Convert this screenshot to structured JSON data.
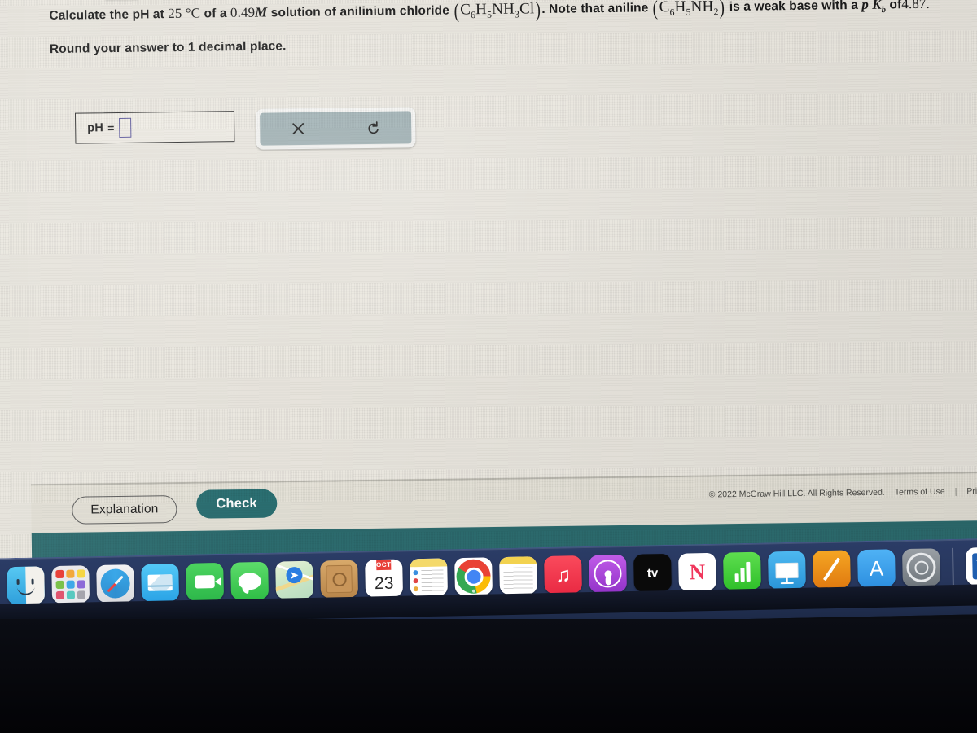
{
  "question": {
    "line1": {
      "part1": "Calculate the pH at",
      "temp": "25 °C",
      "part2": "of a",
      "conc": "0.49",
      "conc_unit": "M",
      "part3": "solution of anilinium chloride",
      "formula1": "C6H5NH3Cl",
      "part4": ". Note that aniline",
      "formula2": "C6H5NH2",
      "part5": "is a weak base with a",
      "pk_symbol": "pK",
      "pk_sub": "b",
      "part6": "of",
      "pk_value": "4.87",
      "period": "."
    },
    "line2": "Round your answer to 1 decimal place."
  },
  "answer": {
    "label": "pH",
    "equals": "=",
    "value": "",
    "placeholder": ""
  },
  "toolbar": {
    "clear_icon": "close-x-icon",
    "undo_icon": "undo-arrow-icon"
  },
  "top_nav": {
    "scroll_icon": "chevron-down-icon"
  },
  "actions": {
    "explanation_label": "Explanation",
    "check_label": "Check"
  },
  "footer": {
    "copyright": "© 2022 McGraw Hill LLC. All Rights Reserved.",
    "terms": "Terms of Use",
    "separator": "|",
    "privacy": "Privacy Ce"
  },
  "colors": {
    "teal": "#2b6f72",
    "page_bg": "#eae7df",
    "input_border": "#56529a",
    "toolbar_bg": "#9fb0b3",
    "dock_bg": "#27365c"
  },
  "dock": {
    "items": [
      {
        "name": "finder",
        "label": "Finder",
        "running": true
      },
      {
        "name": "launchpad",
        "label": "Launchpad",
        "running": false
      },
      {
        "name": "safari",
        "label": "Safari",
        "running": false
      },
      {
        "name": "mail",
        "label": "Mail",
        "running": false
      },
      {
        "name": "facetime",
        "label": "FaceTime",
        "running": false
      },
      {
        "name": "messages",
        "label": "Messages",
        "running": false
      },
      {
        "name": "maps",
        "label": "Maps",
        "running": false
      },
      {
        "name": "contacts",
        "label": "Contacts",
        "running": false
      },
      {
        "name": "calendar",
        "label": "Calendar",
        "month": "OCT",
        "day": "23",
        "running": false
      },
      {
        "name": "notes",
        "label": "Notes",
        "running": false
      },
      {
        "name": "chrome",
        "label": "Google Chrome",
        "running": true
      },
      {
        "name": "reminders",
        "label": "Reminders",
        "running": true
      },
      {
        "name": "music",
        "label": "Music",
        "running": false
      },
      {
        "name": "podcasts",
        "label": "Podcasts",
        "running": false
      },
      {
        "name": "appletv",
        "label": "Apple TV",
        "running": false
      },
      {
        "name": "news",
        "label": "News",
        "running": false
      },
      {
        "name": "numbers",
        "label": "Numbers",
        "running": false
      },
      {
        "name": "keynote",
        "label": "Keynote",
        "running": false
      },
      {
        "name": "pages",
        "label": "Pages",
        "running": false
      },
      {
        "name": "appstore",
        "label": "App Store",
        "running": false
      },
      {
        "name": "system-preferences",
        "label": "System Preferences",
        "running": false
      },
      {
        "name": "word",
        "label": "Microsoft Word",
        "letter": "W",
        "running": true
      }
    ]
  }
}
